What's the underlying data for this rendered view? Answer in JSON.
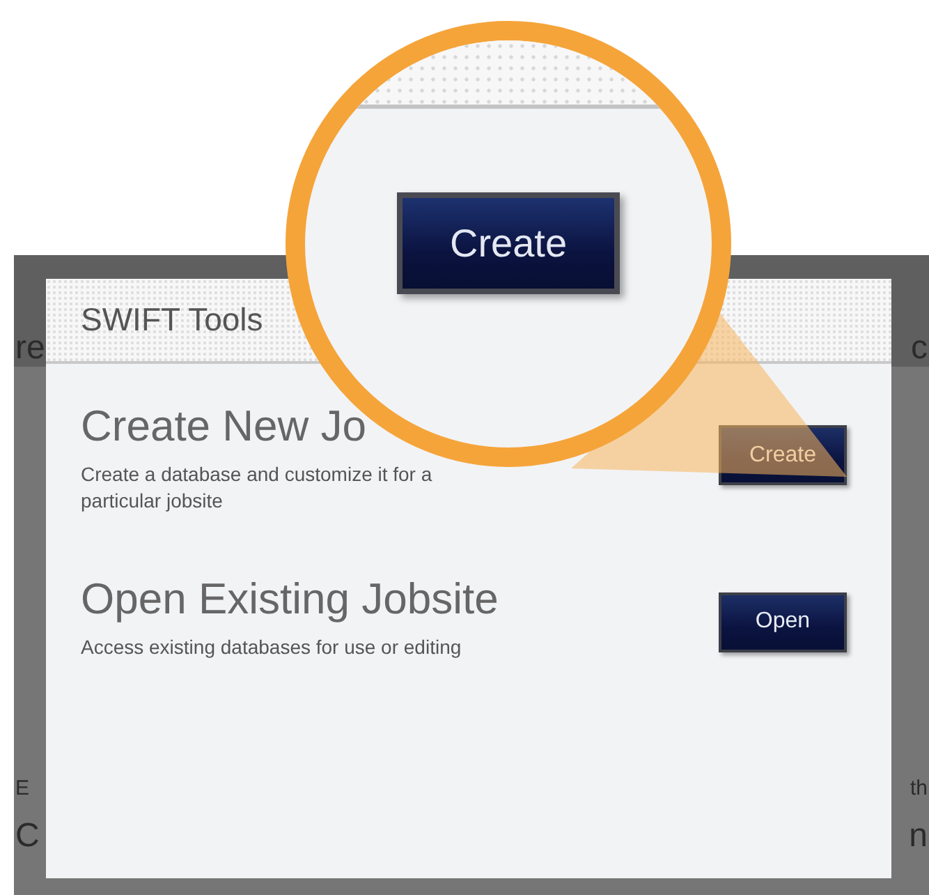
{
  "background_fragments": [
    "re",
    "c",
    "E",
    "th",
    "C",
    "n"
  ],
  "dialog": {
    "title": "SWIFT Tools",
    "options": [
      {
        "title": "Create New Jo",
        "description": "Create a database and customize it for a particular jobsite",
        "button": "Create"
      },
      {
        "title": "Open Existing Jobsite",
        "description": "Access existing databases for use or editing",
        "button": "Open"
      }
    ]
  },
  "magnifier": {
    "button": "Create"
  }
}
